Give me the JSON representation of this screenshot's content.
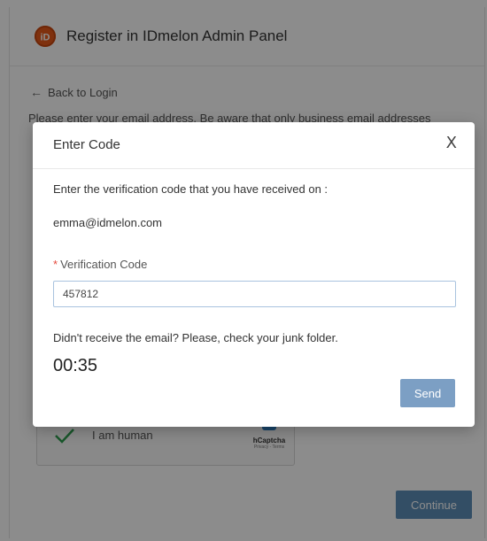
{
  "panel": {
    "title": "Register in IDmelon Admin Panel",
    "logo_icon": "idmelon-logo-icon",
    "back_link": "Back to Login",
    "instructions": "Please enter your email address. Be aware that only business email addresses",
    "captcha": {
      "label": "I am human",
      "brand": "hCaptcha",
      "links": "Privacy - Terms"
    },
    "continue_label": "Continue"
  },
  "modal": {
    "title": "Enter Code",
    "close_label": "X",
    "prompt": "Enter the verification code that you have received on :",
    "email": "emma@idmelon.com",
    "field_label": "Verification Code",
    "required_marker": "*",
    "code_value": "457812",
    "junk_hint": "Didn't receive the email? Please, check your junk folder.",
    "timer": "00:35",
    "send_label": "Send"
  },
  "colors": {
    "brand": "#e85a1a",
    "primary_button": "#7c9fc4",
    "required": "#e5483b",
    "checkmark": "#2e9e4f"
  }
}
